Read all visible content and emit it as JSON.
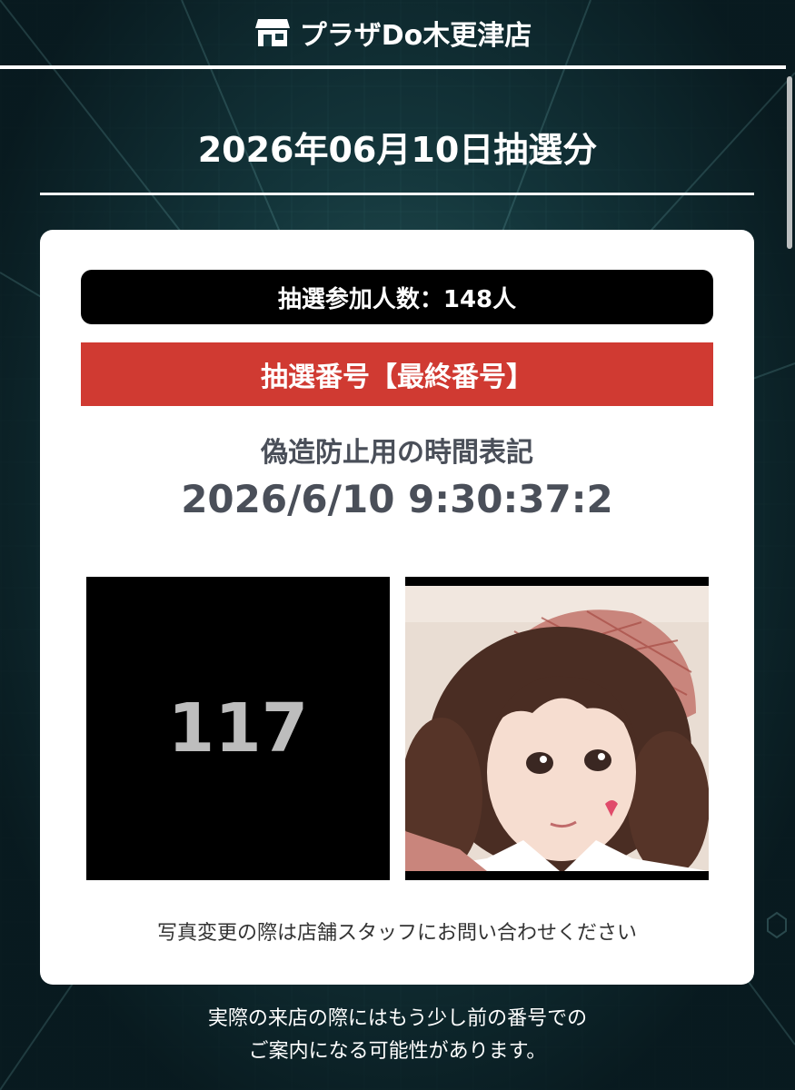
{
  "header": {
    "store_name": "プラザDo木更津店",
    "icon": "store-icon"
  },
  "draw_title": "2026年06月10日抽選分",
  "card": {
    "participants": "抽選参加人数：148人",
    "draw_number_heading": "抽選番号【最終番号】",
    "timestamp_label": "偽造防止用の時間表記",
    "timestamp_value": "2026/6/10 9:30:37:2",
    "draw_number": "117",
    "photo_change_note": "写真変更の際は店舗スタッフにお問い合わせください"
  },
  "footer": {
    "line1": "実際の来店の際にはもう少し前の番号での",
    "line2": "ご案内になる可能性があります。"
  },
  "colors": {
    "accent_red": "#d03a32",
    "text_gray": "#4a4f59",
    "background": "#123238"
  }
}
